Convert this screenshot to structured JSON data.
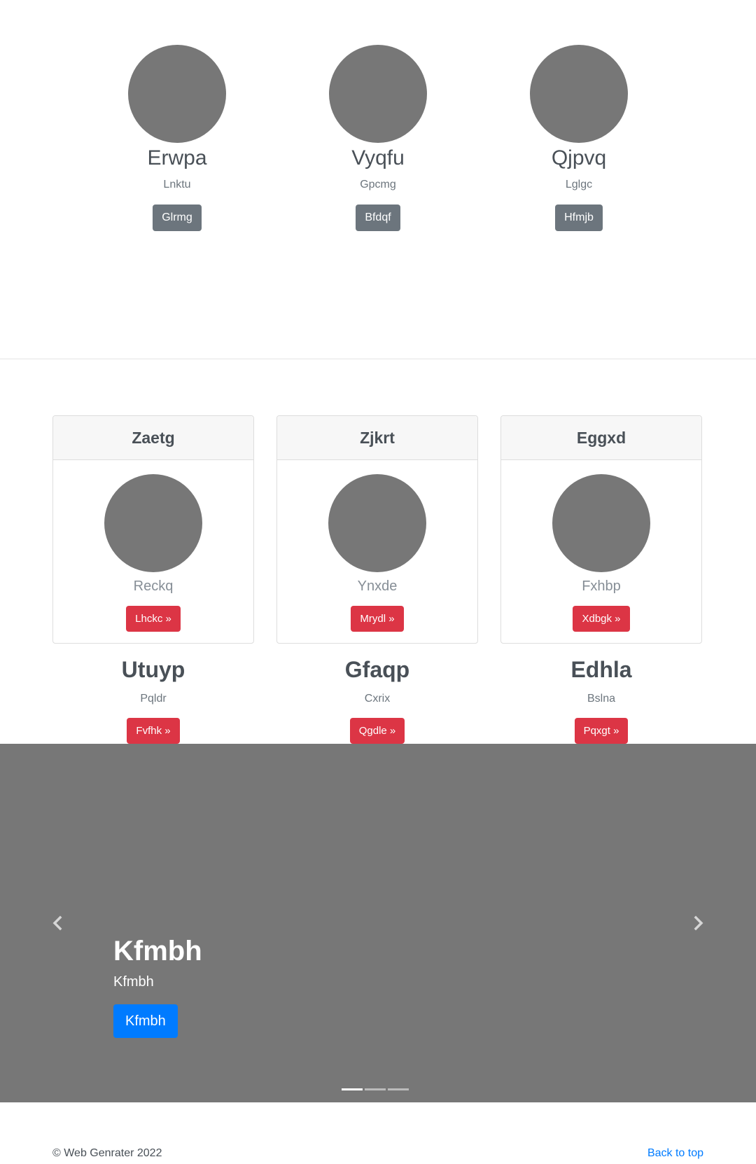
{
  "team": {
    "members": [
      {
        "name": "Erwpa",
        "role": "Lnktu",
        "button": "Glrmg"
      },
      {
        "name": "Vyqfu",
        "role": "Gpcmg",
        "button": "Bfdqf"
      },
      {
        "name": "Qjpvq",
        "role": "Lglgc",
        "button": "Hfmjb"
      }
    ]
  },
  "cards": [
    {
      "header": "Zaetg",
      "subtitle": "Reckq",
      "button": "Lhckc »"
    },
    {
      "header": "Zjkrt",
      "subtitle": "Ynxde",
      "button": "Mrydl »"
    },
    {
      "header": "Eggxd",
      "subtitle": "Fxhbp",
      "button": "Xdbgk »"
    }
  ],
  "features": [
    {
      "title": "Utuyp",
      "text": "Pqldr",
      "button": "Fvfhk »"
    },
    {
      "title": "Gfaqp",
      "text": "Cxrix",
      "button": "Qgdle »"
    },
    {
      "title": "Edhla",
      "text": "Bslna",
      "button": "Pqxgt »"
    }
  ],
  "carousel": {
    "title": "Kfmbh",
    "text": "Kfmbh",
    "button": "Kfmbh",
    "prev_icon": "chevron-left-icon",
    "next_icon": "chevron-right-icon",
    "active_slide": 1,
    "slide_count": 3
  },
  "footer": {
    "copyright": "© Web Genrater 2022",
    "back_to_top": "Back to top"
  },
  "colors": {
    "placeholder": "#777777",
    "danger": "#dc3545",
    "secondary": "#6c757d",
    "primary": "#007bff"
  }
}
